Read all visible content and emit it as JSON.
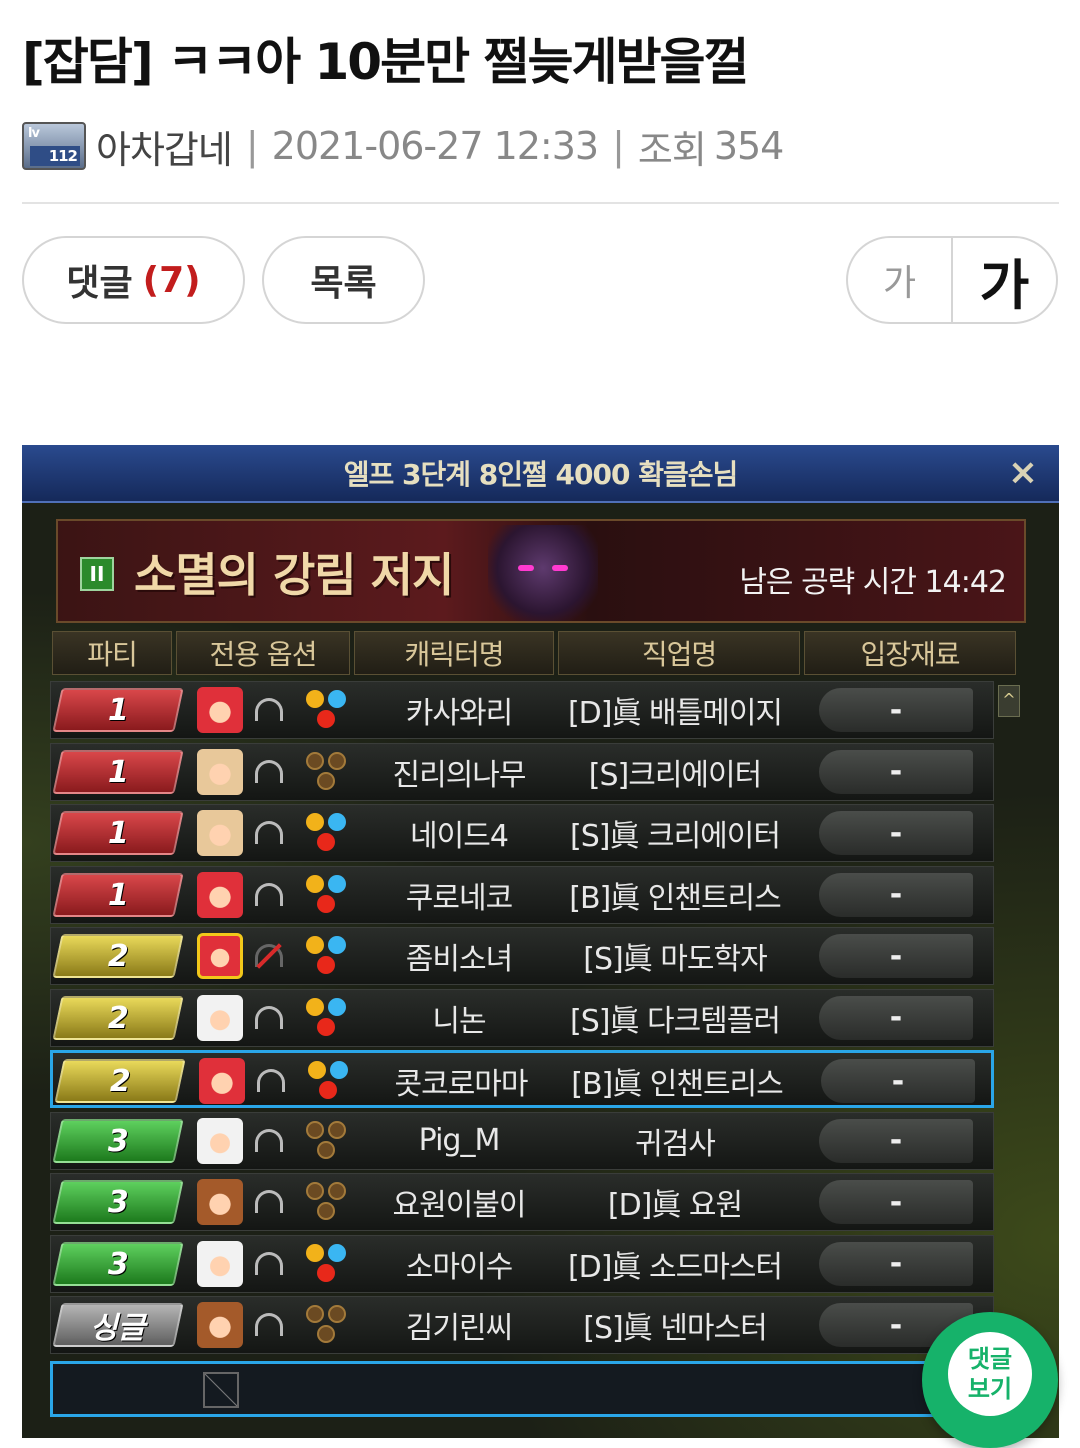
{
  "post": {
    "title": "[잡담] ㅋㅋ아 10분만 쩔늦게받을껄",
    "level_badge": {
      "lv": "lv",
      "num": "112"
    },
    "author": "아차갑네",
    "date": "2021-06-27 12:33",
    "views_label": "조회",
    "views": "354"
  },
  "buttons": {
    "comments_label": "댓글",
    "comments_count": "(7)",
    "list_label": "목록",
    "font_small": "가",
    "font_large": "가"
  },
  "floating": {
    "line1": "댓글",
    "line2": "보기"
  },
  "game": {
    "window_title": "엘프 3단계 8인쩔 4000 확클손님",
    "close_icon": "×",
    "pause_icon": "II",
    "raid_name": "소멸의 강림 저지",
    "timer": "남은 공략 시간 14:42",
    "scroll_up_icon": "^",
    "columns": [
      "파티",
      "전용 옵션",
      "캐릭터명",
      "직업명",
      "입장재료"
    ],
    "rows": [
      {
        "party": "1",
        "party_color": "red",
        "avatar": "red",
        "headset": "on",
        "orbs": "lit",
        "name": "카사와리",
        "job": "[D]眞 배틀메이지",
        "mat": "-"
      },
      {
        "party": "1",
        "party_color": "red",
        "avatar": "blond",
        "headset": "on",
        "orbs": "dim",
        "name": "진리의나무",
        "job": "[S]크리에이터",
        "mat": "-"
      },
      {
        "party": "1",
        "party_color": "red",
        "avatar": "blond",
        "headset": "on",
        "orbs": "lit",
        "name": "네이드4",
        "job": "[S]眞 크리에이터",
        "mat": "-"
      },
      {
        "party": "1",
        "party_color": "red",
        "avatar": "red",
        "headset": "on",
        "orbs": "lit",
        "name": "쿠로네코",
        "job": "[B]眞 인챈트리스",
        "mat": "-"
      },
      {
        "party": "2",
        "party_color": "yellow",
        "avatar": "crown",
        "headset": "muted",
        "orbs": "lit",
        "name": "좀비소녀",
        "job": "[S]眞 마도학자",
        "mat": "-"
      },
      {
        "party": "2",
        "party_color": "yellow",
        "avatar": "white",
        "headset": "on",
        "orbs": "lit",
        "name": "니논",
        "job": "[S]眞 다크템플러",
        "mat": "-"
      },
      {
        "party": "2",
        "party_color": "yellow",
        "avatar": "red",
        "headset": "on",
        "orbs": "lit",
        "name": "콧코로마마",
        "job": "[B]眞 인챈트리스",
        "mat": "-",
        "selected": true
      },
      {
        "party": "3",
        "party_color": "green",
        "avatar": "white",
        "headset": "on",
        "orbs": "dim",
        "name": "Pig_M",
        "job": "귀검사",
        "mat": "-"
      },
      {
        "party": "3",
        "party_color": "green",
        "avatar": "brown",
        "headset": "on",
        "orbs": "dim",
        "name": "요원이불이",
        "job": "[D]眞 요원",
        "mat": "-"
      },
      {
        "party": "3",
        "party_color": "green",
        "avatar": "white",
        "headset": "on",
        "orbs": "lit",
        "name": "소마이수",
        "job": "[D]眞 소드마스터",
        "mat": "-"
      },
      {
        "party": "싱글",
        "party_color": "gray",
        "avatar": "brown",
        "headset": "on",
        "orbs": "dim",
        "name": "김기린씨",
        "job": "[S]眞 넨마스터",
        "mat": "-"
      }
    ]
  }
}
